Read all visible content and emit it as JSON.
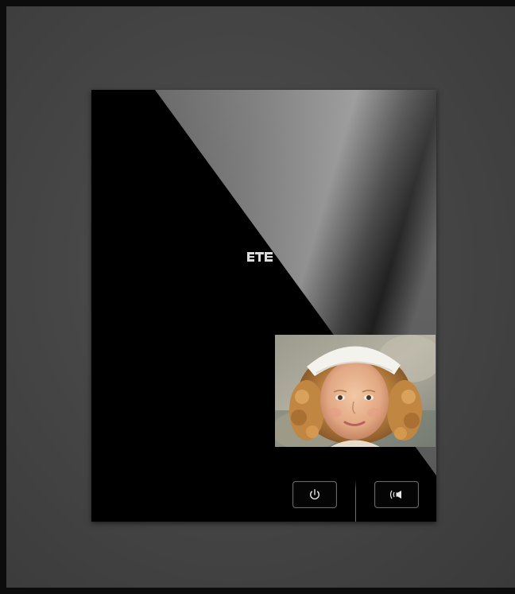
{
  "device": {
    "brand_logo": "ETE",
    "finish_color": "#000000",
    "wall_color": "#4a4a4a",
    "button_icon_color": "#e8e8e8"
  },
  "display": {
    "content": "child-portrait-video-feed"
  },
  "buttons": [
    {
      "id": "power",
      "icon": "power-icon"
    },
    {
      "id": "talk",
      "icon": "speaker-icon"
    },
    {
      "id": "door",
      "icon": "key-icon"
    },
    {
      "id": "light",
      "icon": "light-icon"
    }
  ]
}
